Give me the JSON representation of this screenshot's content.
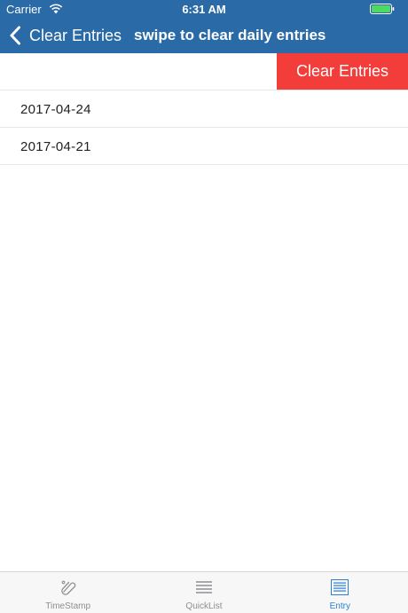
{
  "status_bar": {
    "carrier": "Carrier",
    "time": "6:31 AM",
    "battery_color": "#4cd964"
  },
  "nav": {
    "back_label": "Clear Entries",
    "title": "swipe to clear daily entries",
    "bar_color": "#2a6aa6"
  },
  "list": {
    "rows": [
      {
        "label": "",
        "swipe_action": "Clear Entries"
      },
      {
        "label": "2017-04-24"
      },
      {
        "label": "2017-04-21"
      }
    ],
    "action_color": "#f23d3a"
  },
  "tab_bar": {
    "tabs": [
      {
        "label": "TimeStamp",
        "icon": "paperclip-icon",
        "active": false
      },
      {
        "label": "QuickList",
        "icon": "list-icon",
        "active": false
      },
      {
        "label": "Entry",
        "icon": "document-icon",
        "active": true
      }
    ],
    "active_color": "#2a7fd4"
  }
}
